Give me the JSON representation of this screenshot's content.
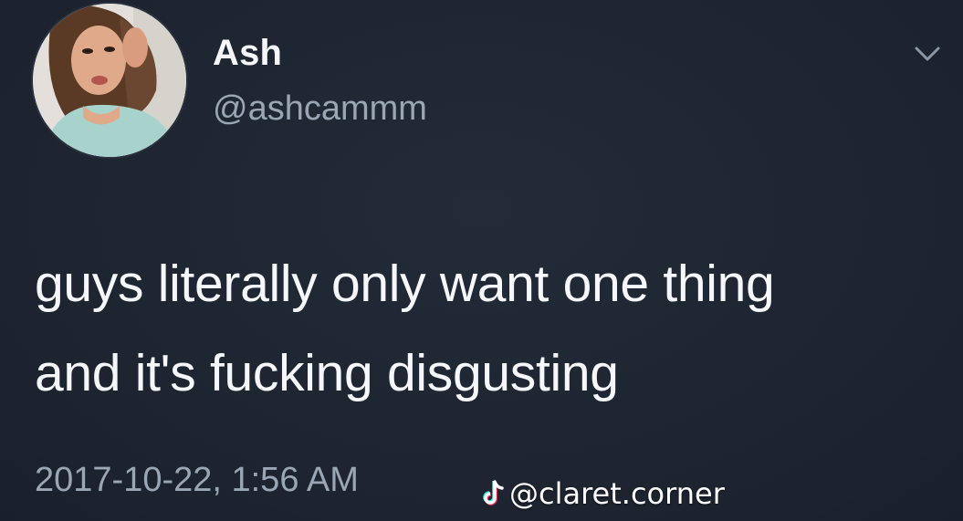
{
  "tweet": {
    "author_name": "Ash",
    "author_handle": "@ashcammm",
    "text_lines": [
      "guys literally only want one thing",
      "and it's fucking disgusting"
    ],
    "timestamp": "2017-10-22, 1:56 AM"
  },
  "watermark": {
    "logo_icon": "tiktok-icon",
    "text": "@claret.corner"
  },
  "icons": {
    "menu": "chevron-down-icon",
    "avatar": "profile-photo"
  },
  "colors": {
    "background": "#1f2632",
    "primary_text": "#f5f7fa",
    "secondary_text": "#9aa6b4"
  }
}
